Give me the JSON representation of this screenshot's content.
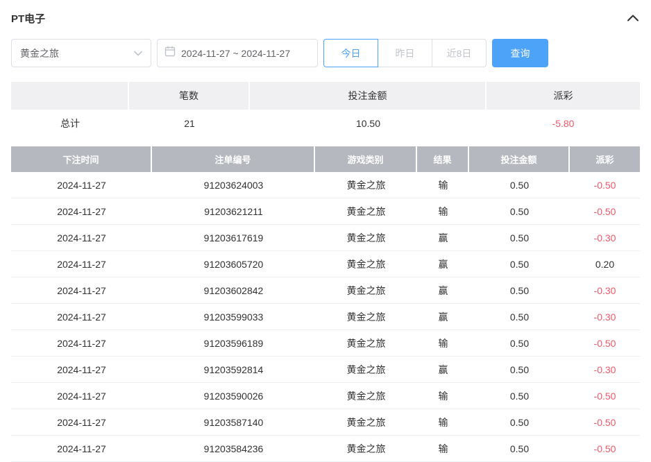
{
  "header": {
    "title": "PT电子",
    "collapse_icon": "chevron-up-icon"
  },
  "filters": {
    "game_select": {
      "value": "黄金之旅",
      "icon": "chevron-down-icon"
    },
    "date_range": {
      "value": "2024-11-27 ~ 2024-11-27",
      "icon": "calendar-icon"
    },
    "quick_buttons": [
      {
        "label": "今日",
        "active": true
      },
      {
        "label": "昨日",
        "active": false
      },
      {
        "label": "近8日",
        "active": false
      }
    ],
    "search_label": "查询"
  },
  "summary": {
    "headers": [
      "",
      "笔数",
      "投注金额",
      "派彩"
    ],
    "row": {
      "label": "总计",
      "count": "21",
      "bet_amount": "10.50",
      "payout": "-5.80"
    }
  },
  "table": {
    "headers": [
      "下注时间",
      "注单编号",
      "游戏类别",
      "结果",
      "投注金额",
      "派彩"
    ],
    "rows": [
      {
        "date": "2024-11-27",
        "order_id": "91203624003",
        "game": "黄金之旅",
        "result": "输",
        "bet": "0.50",
        "payout": "-0.50"
      },
      {
        "date": "2024-11-27",
        "order_id": "91203621211",
        "game": "黄金之旅",
        "result": "输",
        "bet": "0.50",
        "payout": "-0.50"
      },
      {
        "date": "2024-11-27",
        "order_id": "91203617619",
        "game": "黄金之旅",
        "result": "赢",
        "bet": "0.50",
        "payout": "-0.30"
      },
      {
        "date": "2024-11-27",
        "order_id": "91203605720",
        "game": "黄金之旅",
        "result": "赢",
        "bet": "0.50",
        "payout": "0.20"
      },
      {
        "date": "2024-11-27",
        "order_id": "91203602842",
        "game": "黄金之旅",
        "result": "赢",
        "bet": "0.50",
        "payout": "-0.30"
      },
      {
        "date": "2024-11-27",
        "order_id": "91203599033",
        "game": "黄金之旅",
        "result": "赢",
        "bet": "0.50",
        "payout": "-0.30"
      },
      {
        "date": "2024-11-27",
        "order_id": "91203596189",
        "game": "黄金之旅",
        "result": "输",
        "bet": "0.50",
        "payout": "-0.50"
      },
      {
        "date": "2024-11-27",
        "order_id": "91203592814",
        "game": "黄金之旅",
        "result": "赢",
        "bet": "0.50",
        "payout": "-0.30"
      },
      {
        "date": "2024-11-27",
        "order_id": "91203590026",
        "game": "黄金之旅",
        "result": "输",
        "bet": "0.50",
        "payout": "-0.50"
      },
      {
        "date": "2024-11-27",
        "order_id": "91203587140",
        "game": "黄金之旅",
        "result": "输",
        "bet": "0.50",
        "payout": "-0.50"
      },
      {
        "date": "2024-11-27",
        "order_id": "91203584236",
        "game": "黄金之旅",
        "result": "输",
        "bet": "0.50",
        "payout": "-0.50"
      }
    ]
  },
  "colors": {
    "accent": "#4da3f7",
    "negative": "#f0586a",
    "table_header_bg": "#b5b8be",
    "summary_header_bg": "#f0f0f2"
  }
}
